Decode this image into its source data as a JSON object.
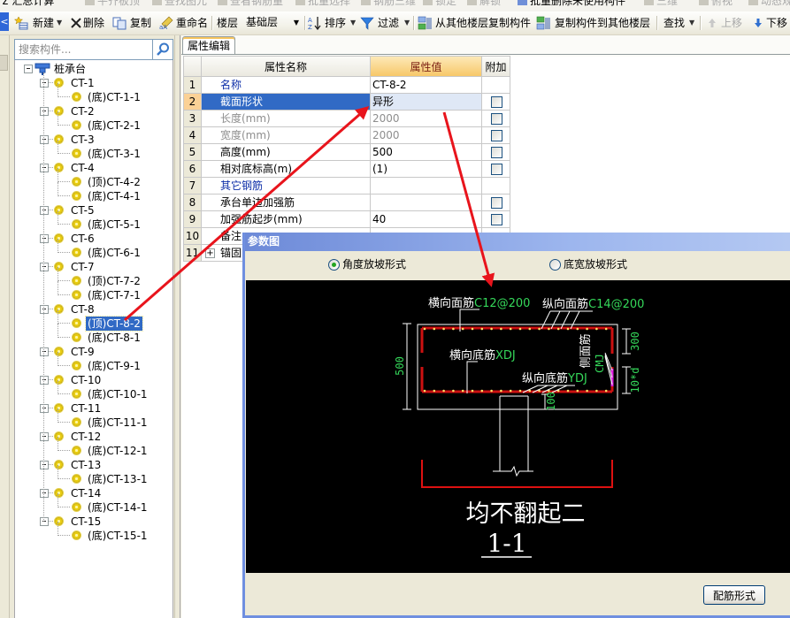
{
  "top_toolbar": {
    "items": [
      "汇总计算",
      "平齐板顶",
      "查找图元",
      "查看钢筋量",
      "批量选择",
      "钢筋三维",
      "锁定",
      "解锁",
      "批量删除未使用构件",
      "三维",
      "俯视",
      "动态观察"
    ]
  },
  "toolbar": {
    "collapse": "<",
    "new": "新建",
    "delete": "删除",
    "copy": "复制",
    "rename": "重命名",
    "floor_label": "楼层",
    "floor_value": "基础层",
    "sort": "排序",
    "filter": "过滤",
    "copy_from_floor": "从其他楼层复制构件",
    "copy_to_floor": "复制构件到其他楼层",
    "find": "查找",
    "move_up": "上移",
    "move_down": "下移"
  },
  "sidebar": {
    "search_placeholder": "搜索构件...",
    "root": "桩承台",
    "selected": "(顶)CT-8-2",
    "groups": [
      {
        "label": "CT-1",
        "children": [
          "(底)CT-1-1"
        ]
      },
      {
        "label": "CT-2",
        "children": [
          "(底)CT-2-1"
        ]
      },
      {
        "label": "CT-3",
        "children": [
          "(底)CT-3-1"
        ]
      },
      {
        "label": "CT-4",
        "children": [
          "(顶)CT-4-2",
          "(底)CT-4-1"
        ]
      },
      {
        "label": "CT-5",
        "children": [
          "(底)CT-5-1"
        ]
      },
      {
        "label": "CT-6",
        "children": [
          "(底)CT-6-1"
        ]
      },
      {
        "label": "CT-7",
        "children": [
          "(顶)CT-7-2",
          "(底)CT-7-1"
        ]
      },
      {
        "label": "CT-8",
        "children": [
          "(顶)CT-8-2",
          "(底)CT-8-1"
        ]
      },
      {
        "label": "CT-9",
        "children": [
          "(底)CT-9-1"
        ]
      },
      {
        "label": "CT-10",
        "children": [
          "(底)CT-10-1"
        ]
      },
      {
        "label": "CT-11",
        "children": [
          "(底)CT-11-1"
        ]
      },
      {
        "label": "CT-12",
        "children": [
          "(底)CT-12-1"
        ]
      },
      {
        "label": "CT-13",
        "children": [
          "(底)CT-13-1"
        ]
      },
      {
        "label": "CT-14",
        "children": [
          "(底)CT-14-1"
        ]
      },
      {
        "label": "CT-15",
        "children": [
          "(底)CT-15-1"
        ]
      }
    ]
  },
  "properties": {
    "tab": "属性编辑",
    "columns": [
      "",
      "属性名称",
      "属性值",
      "附加"
    ],
    "selected_row": 2,
    "rows": [
      {
        "num": "1",
        "name": "名称",
        "value": "CT-8-2",
        "style": "category",
        "checkbox": false
      },
      {
        "num": "2",
        "name": "截面形状",
        "value": "异形",
        "style": "normal",
        "checkbox": true
      },
      {
        "num": "3",
        "name": "长度(mm)",
        "value": "2000",
        "style": "disabled",
        "checkbox": true
      },
      {
        "num": "4",
        "name": "宽度(mm)",
        "value": "2000",
        "style": "disabled",
        "checkbox": true
      },
      {
        "num": "5",
        "name": "高度(mm)",
        "value": "500",
        "style": "normal",
        "checkbox": true
      },
      {
        "num": "6",
        "name": "相对底标高(m)",
        "value": " (1)",
        "style": "normal",
        "checkbox": true
      },
      {
        "num": "7",
        "name": "其它钢筋",
        "value": "",
        "style": "category",
        "checkbox": false
      },
      {
        "num": "8",
        "name": "承台单边加强筋",
        "value": "",
        "style": "normal",
        "checkbox": true
      },
      {
        "num": "9",
        "name": "加强筋起步(mm)",
        "value": "40",
        "style": "normal",
        "checkbox": true
      },
      {
        "num": "10",
        "name": "备注",
        "value": "",
        "style": "normal",
        "checkbox": false
      },
      {
        "num": "11",
        "name": "锚固",
        "value": "",
        "style": "normal",
        "checkbox": false,
        "expandable": true
      }
    ]
  },
  "dialog": {
    "title": "参数图",
    "options": [
      {
        "label": "角度放坡形式",
        "checked": true
      },
      {
        "label": "底宽放坡形式",
        "checked": false
      }
    ],
    "drawing": {
      "top_transverse": {
        "label": "横向面筋",
        "code": "C12@200"
      },
      "top_longitudinal": {
        "label": "纵向面筋",
        "code": "C14@200"
      },
      "bottom_transverse": {
        "label": "横向底筋",
        "code": "XDJ"
      },
      "bottom_longitudinal": {
        "label": "纵向底筋",
        "code": "YDJ"
      },
      "side": {
        "label": "侧面筋",
        "code": "CMJ"
      },
      "dim_height": "500",
      "dim_side_top": "300",
      "dim_side_bottom": "10*d",
      "dim_pile_embed": "100",
      "note": "均不翻起二",
      "section": "1-1"
    },
    "button": "配筋形式"
  },
  "colors": {
    "selection": "#316ac5",
    "annotation_arrow": "#e8141c",
    "drawing_text_green": "#35d85a",
    "rebar_red": "#cc1111",
    "dialog_title": "#6d8ad8"
  }
}
